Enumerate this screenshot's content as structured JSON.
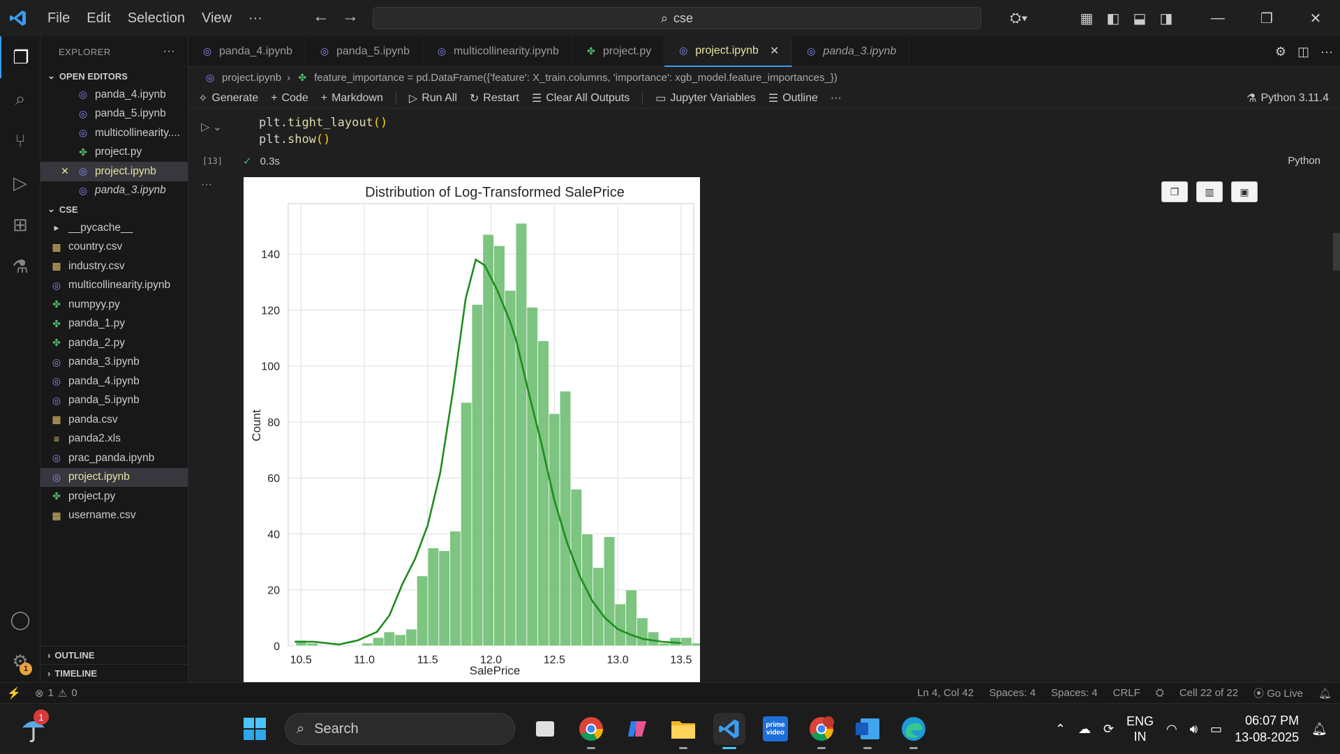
{
  "menu": [
    "File",
    "Edit",
    "Selection",
    "View",
    "···"
  ],
  "search": {
    "text": "cse"
  },
  "sidebar": {
    "explorer_title": "EXPLORER",
    "open_editors_title": "OPEN EDITORS",
    "open_editors": [
      {
        "label": "panda_4.ipynb",
        "type": "nb"
      },
      {
        "label": "panda_5.ipynb",
        "type": "nb"
      },
      {
        "label": "multicollinearity....",
        "type": "nb"
      },
      {
        "label": "project.py",
        "type": "py"
      },
      {
        "label": "project.ipynb",
        "type": "nb"
      },
      {
        "label": "panda_3.ipynb",
        "type": "nb"
      }
    ],
    "folder_title": "CSE",
    "files": [
      {
        "label": "__pycache__",
        "type": "folder"
      },
      {
        "label": "country.csv",
        "type": "csv"
      },
      {
        "label": "industry.csv",
        "type": "csv"
      },
      {
        "label": "multicollinearity.ipynb",
        "type": "nb"
      },
      {
        "label": "numpyy.py",
        "type": "py"
      },
      {
        "label": "panda_1.py",
        "type": "py"
      },
      {
        "label": "panda_2.py",
        "type": "py"
      },
      {
        "label": "panda_3.ipynb",
        "type": "nb"
      },
      {
        "label": "panda_4.ipynb",
        "type": "nb"
      },
      {
        "label": "panda_5.ipynb",
        "type": "nb"
      },
      {
        "label": "panda.csv",
        "type": "csv"
      },
      {
        "label": "panda2.xls",
        "type": "xls"
      },
      {
        "label": "prac_panda.ipynb",
        "type": "nb"
      },
      {
        "label": "project.ipynb",
        "type": "nb"
      },
      {
        "label": "project.py",
        "type": "py"
      },
      {
        "label": "username.csv",
        "type": "csv"
      }
    ],
    "outline": "OUTLINE",
    "timeline": "TIMELINE"
  },
  "tabs": [
    {
      "label": "panda_4.ipynb"
    },
    {
      "label": "panda_5.ipynb"
    },
    {
      "label": "multicollinearity.ipynb"
    },
    {
      "label": "project.py"
    },
    {
      "label": "project.ipynb"
    },
    {
      "label": "panda_3.ipynb"
    }
  ],
  "breadcrumb": {
    "file": "project.ipynb",
    "cell": "feature_importance = pd.DataFrame({'feature': X_train.columns, 'importance': xgb_model.feature_importances_})"
  },
  "toolbar": {
    "generate": "Generate",
    "code": "Code",
    "markdown": "Markdown",
    "run_all": "Run All",
    "restart": "Restart",
    "clear": "Clear All Outputs",
    "variables": "Jupyter Variables",
    "outline": "Outline",
    "more": "···",
    "kernel": "Python 3.11.4"
  },
  "cell": {
    "line1_obj": "plt",
    "line1_fn": "tight_layout",
    "line2_obj": "plt",
    "line2_fn": "show",
    "exec_count": "[13]",
    "duration": "0.3s",
    "language": "Python",
    "output_dots": "···"
  },
  "chart_data": {
    "type": "bar",
    "title": "Distribution of Log-Transformed SalePrice",
    "xlabel": "SalePrice",
    "ylabel": "Count",
    "xlim": [
      10.4,
      13.6
    ],
    "ylim": [
      0,
      158
    ],
    "xticks": [
      10.5,
      11.0,
      11.5,
      12.0,
      12.5,
      13.0,
      13.5
    ],
    "yticks": [
      0,
      20,
      40,
      60,
      80,
      100,
      120,
      140
    ],
    "bin_start": 10.46,
    "bin_width": 0.0868,
    "values": [
      2,
      1,
      0,
      0,
      0,
      0,
      1,
      3,
      5,
      4,
      6,
      25,
      35,
      34,
      41,
      87,
      122,
      147,
      143,
      127,
      151,
      121,
      109,
      83,
      91,
      56,
      40,
      28,
      39,
      15,
      20,
      10,
      5,
      1,
      3,
      3,
      1,
      1
    ],
    "kde": [
      [
        10.45,
        1.5
      ],
      [
        10.6,
        1.5
      ],
      [
        10.8,
        0.5
      ],
      [
        10.95,
        2
      ],
      [
        11.1,
        5
      ],
      [
        11.2,
        11
      ],
      [
        11.3,
        22
      ],
      [
        11.4,
        31
      ],
      [
        11.5,
        43
      ],
      [
        11.6,
        62
      ],
      [
        11.7,
        91
      ],
      [
        11.8,
        124
      ],
      [
        11.88,
        138
      ],
      [
        11.95,
        136
      ],
      [
        12.05,
        127
      ],
      [
        12.15,
        116
      ],
      [
        12.2,
        109
      ],
      [
        12.3,
        90
      ],
      [
        12.4,
        72
      ],
      [
        12.5,
        52
      ],
      [
        12.6,
        37
      ],
      [
        12.7,
        25
      ],
      [
        12.8,
        16
      ],
      [
        12.9,
        10
      ],
      [
        13.0,
        6
      ],
      [
        13.1,
        4
      ],
      [
        13.2,
        2.5
      ],
      [
        13.35,
        1.5
      ],
      [
        13.5,
        1
      ]
    ],
    "grid": true,
    "bar_color": "#66bb6a",
    "line_color": "#1e8c1e"
  },
  "status": {
    "errors": "1",
    "warnings": "0",
    "position": "Ln 4, Col 42",
    "spaces1": "Spaces: 4",
    "spaces2": "Spaces: 4",
    "eol": "CRLF",
    "cell": "Cell 22 of 22",
    "golive": "Go Live"
  },
  "taskbar": {
    "weather_badge": "1",
    "search": "Search",
    "lang1": "ENG",
    "lang2": "IN",
    "time": "06:07 PM",
    "date": "13-08-2025"
  }
}
